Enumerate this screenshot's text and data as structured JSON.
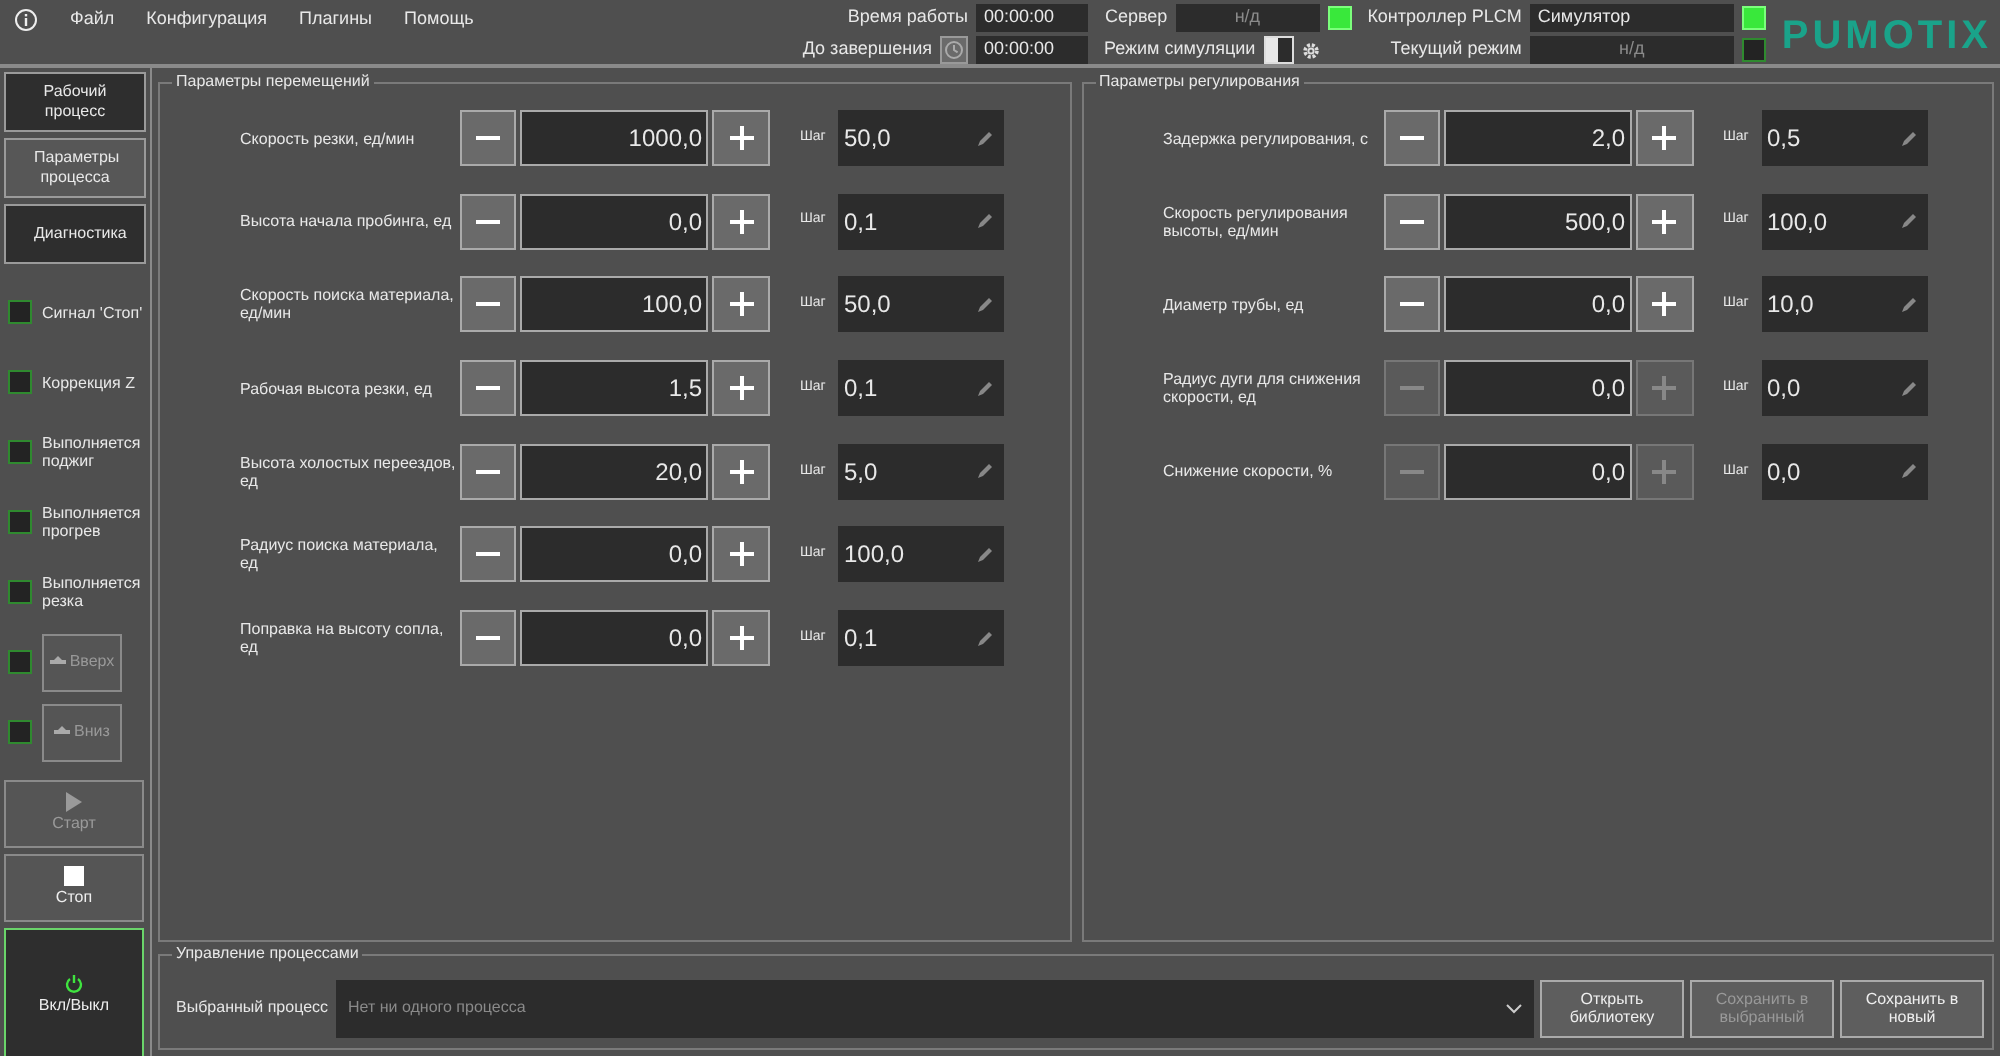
{
  "menu": [
    "Файл",
    "Конфигурация",
    "Плагины",
    "Помощь"
  ],
  "header": {
    "uptime": {
      "label": "Время работы",
      "value": "00:00:00"
    },
    "remaining": {
      "label": "До завершения",
      "value": "00:00:00"
    },
    "server": {
      "label": "Сервер",
      "value": "н/д",
      "on": true
    },
    "simulation": {
      "label": "Режим симуляции",
      "on": false
    },
    "controller": {
      "label": "Контроллер PLCM",
      "value": "Симулятор",
      "on": true
    },
    "current_mode": {
      "label": "Текущий режим",
      "value": "н/д",
      "on": false
    },
    "logo": "PUMOTIX"
  },
  "sidebar": {
    "tabs": [
      {
        "label": "Рабочий процесс",
        "selected": false
      },
      {
        "label": "Параметры процесса",
        "selected": true
      },
      {
        "label": "Диагностика",
        "selected": false
      }
    ],
    "signals": [
      {
        "kind": "label",
        "label": "Сигнал 'Стоп'",
        "on": false
      },
      {
        "kind": "label",
        "label": "Коррекция Z",
        "on": false
      },
      {
        "kind": "label",
        "label": "Выполняется поджиг",
        "on": false
      },
      {
        "kind": "label",
        "label": "Выполняется прогрев",
        "on": false
      },
      {
        "kind": "label",
        "label": "Выполняется резка",
        "on": false
      },
      {
        "kind": "button",
        "label": "Вверх",
        "on": false,
        "disabled": true
      },
      {
        "kind": "button",
        "label": "Вниз",
        "on": false,
        "disabled": true
      }
    ],
    "start": {
      "label": "Старт",
      "disabled": true
    },
    "stop": {
      "label": "Стоп",
      "disabled": false
    },
    "power": {
      "label": "Вкл/Выкл"
    }
  },
  "panels": [
    {
      "title": "Параметры перемещений",
      "rows": [
        {
          "label": "Скорость резки, ед/мин",
          "value": "1000,0",
          "step_label": "Шаг",
          "step": "50,0",
          "disabled": false
        },
        {
          "label": "Высота начала пробинга, ед",
          "value": "0,0",
          "step_label": "Шаг",
          "step": "0,1",
          "disabled": false
        },
        {
          "label": "Скорость поиска материала, ед/мин",
          "value": "100,0",
          "step_label": "Шаг",
          "step": "50,0",
          "disabled": false
        },
        {
          "label": "Рабочая высота резки, ед",
          "value": "1,5",
          "step_label": "Шаг",
          "step": "0,1",
          "disabled": false
        },
        {
          "label": "Высота холостых переездов, ед",
          "value": "20,0",
          "step_label": "Шаг",
          "step": "5,0",
          "disabled": false
        },
        {
          "label": "Радиус поиска материала, ед",
          "value": "0,0",
          "step_label": "Шаг",
          "step": "100,0",
          "disabled": false
        },
        {
          "label": "Поправка на высоту сопла, ед",
          "value": "0,0",
          "step_label": "Шаг",
          "step": "0,1",
          "disabled": false
        }
      ]
    },
    {
      "title": "Параметры регулирования",
      "rows": [
        {
          "label": "Задержка регулирования, с",
          "value": "2,0",
          "step_label": "Шаг",
          "step": "0,5",
          "disabled": false
        },
        {
          "label": "Скорость регулирования высоты, ед/мин",
          "value": "500,0",
          "step_label": "Шаг",
          "step": "100,0",
          "disabled": false
        },
        {
          "label": "Диаметр трубы, ед",
          "value": "0,0",
          "step_label": "Шаг",
          "step": "10,0",
          "disabled": false
        },
        {
          "label": "Радиус дуги для снижения скорости, ед",
          "value": "0,0",
          "step_label": "Шаг",
          "step": "0,0",
          "disabled": true
        },
        {
          "label": "Снижение скорости, %",
          "value": "0,0",
          "step_label": "Шаг",
          "step": "0,0",
          "disabled": true
        }
      ]
    }
  ],
  "process": {
    "title": "Управление процессами",
    "label": "Выбранный процесс",
    "placeholder": "Нет ни одного процесса",
    "buttons": [
      {
        "label": "Открыть библиотеку",
        "disabled": false
      },
      {
        "label": "Сохранить в выбранный",
        "disabled": true
      },
      {
        "label": "Сохранить в новый",
        "disabled": false
      }
    ]
  }
}
